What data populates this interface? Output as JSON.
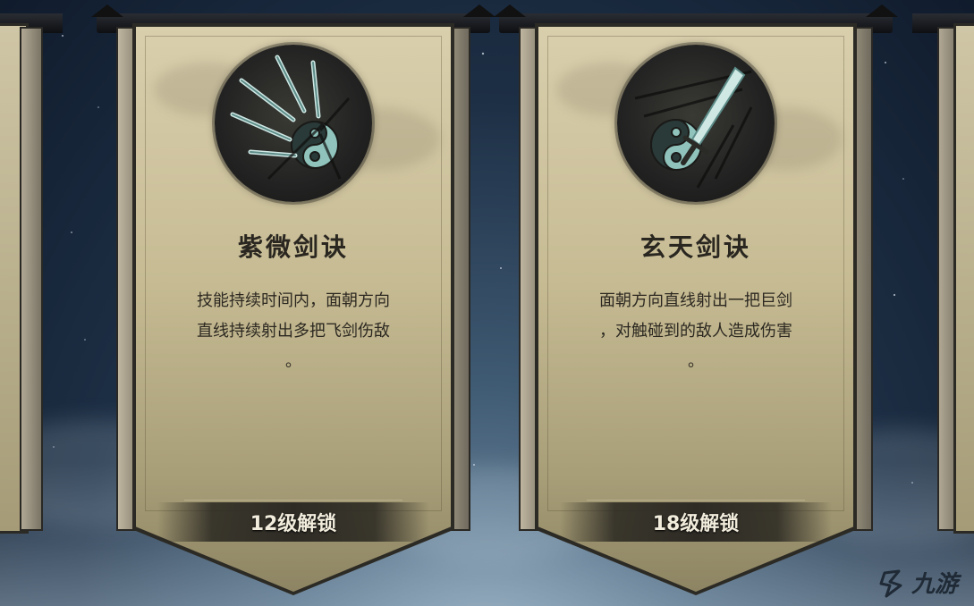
{
  "skills": [
    {
      "name": "紫微剑诀",
      "desc_line1": "技能持续时间内，面朝方向",
      "desc_line2": "直线持续射出多把飞剑伤敌",
      "desc_line3": "。",
      "unlock": "12级解锁",
      "icon": "flying-swords-icon"
    },
    {
      "name": "玄天剑诀",
      "desc_line1": "面朝方向直线射出一把巨剑",
      "desc_line2": "，对触碰到的敌人造成伤害",
      "desc_line3": "。",
      "unlock": "18级解锁",
      "icon": "giant-sword-icon"
    }
  ],
  "watermark": {
    "text": "九游",
    "icon": "jiuyou-logo-icon"
  },
  "colors": {
    "banner_cloth": "#c6bb93",
    "emblem_dark": "#222222",
    "sword_jade": "#7fb6b0",
    "unlock_text": "#f1ecdc"
  }
}
